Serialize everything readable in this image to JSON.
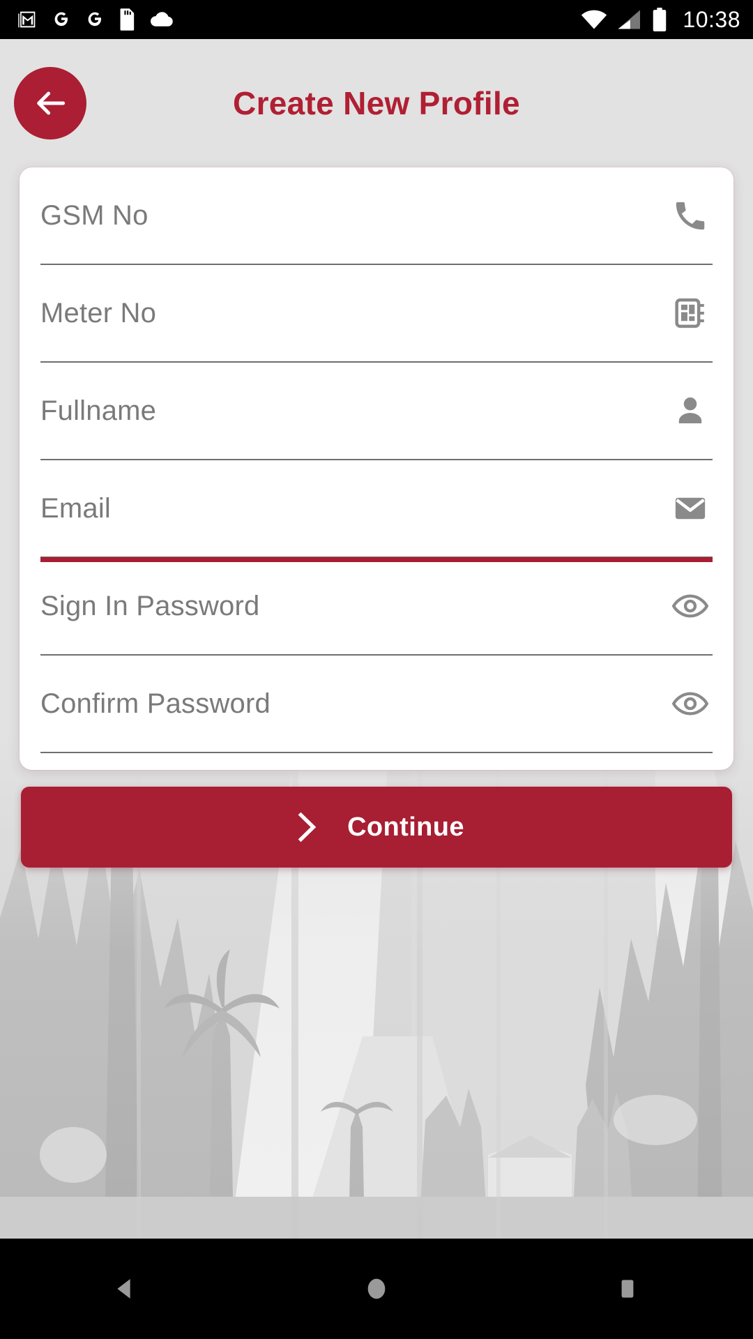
{
  "statusbar": {
    "time": "10:38",
    "left_icons": [
      "gmail-icon",
      "google-icon",
      "google-icon",
      "sd-card-icon",
      "cloud-icon"
    ],
    "right_icons": [
      "wifi-icon",
      "cellular-signal-icon",
      "battery-icon"
    ]
  },
  "header": {
    "title": "Create New Profile",
    "back_icon": "arrow-left-icon",
    "accent_color": "#B01F33"
  },
  "form": {
    "fields": [
      {
        "label": "GSM No",
        "value": "",
        "icon": "phone-icon",
        "focused": false
      },
      {
        "label": "Meter No",
        "value": "",
        "icon": "meter-icon",
        "focused": false
      },
      {
        "label": "Fullname",
        "value": "",
        "icon": "person-icon",
        "focused": false
      },
      {
        "label": "Email",
        "value": "",
        "icon": "envelope-icon",
        "focused": true
      },
      {
        "label": "Sign In Password",
        "value": "",
        "icon": "eye-icon",
        "focused": false
      },
      {
        "label": "Confirm Password",
        "value": "",
        "icon": "eye-icon",
        "focused": false
      }
    ]
  },
  "continue_button": {
    "label": "Continue",
    "icon": "chevron-right-icon",
    "color": "#A81E33"
  },
  "navbar": {
    "back_label": "back-triangle-icon",
    "home_label": "home-circle-icon",
    "recents_label": "recents-square-icon"
  },
  "colors": {
    "brand_red": "#A81E33",
    "title_red": "#B01F33",
    "page_background": "#DEDEDE",
    "card_background": "#FFFFFF",
    "label_gray": "#7A7A7A",
    "underline_gray": "#6E6E6E"
  }
}
